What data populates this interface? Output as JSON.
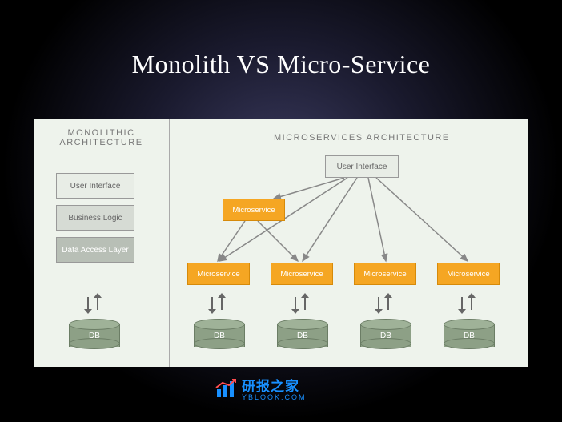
{
  "title": "Monolith VS Micro-Service",
  "left": {
    "heading": "MONOLITHIC ARCHITECTURE",
    "layers": {
      "ui": "User Interface",
      "bl": "Business Logic",
      "da": "Data Access Layer"
    },
    "db": "DB"
  },
  "right": {
    "heading": "MICROSERVICES ARCHITECTURE",
    "ui": "User Interface",
    "ms": "Microservice",
    "db": "DB"
  },
  "watermark": {
    "name": "研报之家",
    "url": "YBLOOK.COM"
  }
}
